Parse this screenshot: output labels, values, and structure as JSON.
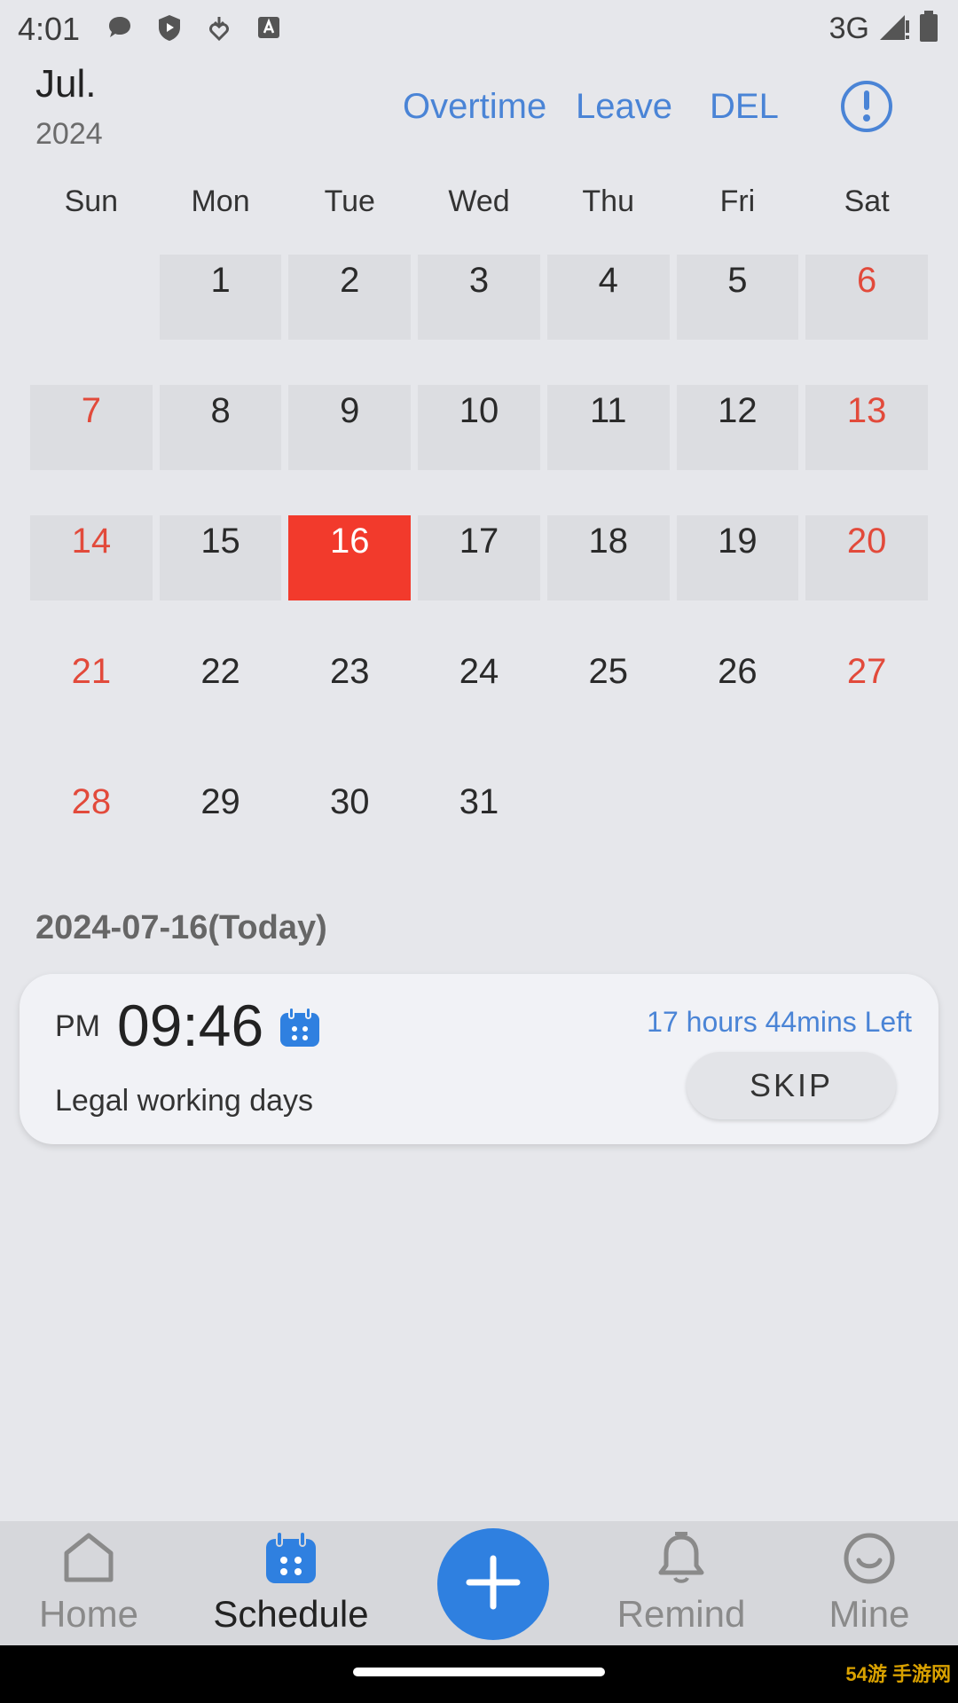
{
  "status_bar": {
    "time": "4:01",
    "network": "3G"
  },
  "header": {
    "month": "Jul.",
    "year": "2024",
    "overtime": "Overtime",
    "leave": "Leave",
    "del": "DEL"
  },
  "weekdays": [
    "Sun",
    "Mon",
    "Tue",
    "Wed",
    "Thu",
    "Fri",
    "Sat"
  ],
  "calendar": {
    "cells": [
      "",
      "1",
      "2",
      "3",
      "4",
      "5",
      "6",
      "7",
      "8",
      "9",
      "10",
      "11",
      "12",
      "13",
      "14",
      "15",
      "16",
      "17",
      "18",
      "19",
      "20",
      "21",
      "22",
      "23",
      "24",
      "25",
      "26",
      "27",
      "28",
      "29",
      "30",
      "31",
      "",
      "",
      ""
    ],
    "today": "16",
    "weekend_color": "#e24a3b",
    "today_color": "#f23a2c"
  },
  "today_section": {
    "label": "2024-07-16(Today)",
    "ampm": "PM",
    "time": "09:46",
    "remaining": "17 hours 44mins Left",
    "description": "Legal working days",
    "skip": "SKIP"
  },
  "bottom_nav": {
    "home": "Home",
    "schedule": "Schedule",
    "remind": "Remind",
    "mine": "Mine"
  },
  "watermark": "54游 手游网"
}
